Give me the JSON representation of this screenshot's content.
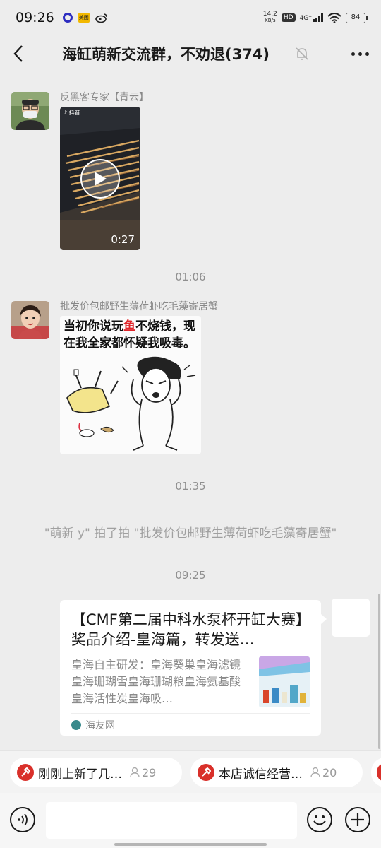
{
  "status_bar": {
    "time": "09:26",
    "net_speed_value": "14.2",
    "net_speed_unit": "KB/s",
    "hd": "HD",
    "network": "4G⁺",
    "battery": "84",
    "app_badge": "美团"
  },
  "nav": {
    "title": "海缸萌新交流群，不劝退(374)"
  },
  "messages": [
    {
      "sender": "反黑客专家【青云】",
      "type": "video",
      "duration": "0:27",
      "tiktok_label": "抖音"
    },
    {
      "sender": "批发价包邮野生薄荷虾吃毛藻寄居蟹",
      "type": "sticker",
      "caption_parts": [
        "当初你说玩",
        "鱼",
        "不烧钱，现在我全家都怀疑我吸毒。"
      ]
    }
  ],
  "timestamps": [
    "01:06",
    "01:35",
    "09:25"
  ],
  "system_notice": "\"萌新 y\" 拍了拍 \"批发价包邮野生薄荷虾吃毛藻寄居蟹\"",
  "link_card": {
    "title": "【CMF第二届中科水泵杯开缸大赛】奖品介绍-皇海篇，转发送…",
    "description": "皇海自主研发：皇海葵巢皇海滤镜皇海珊瑚雪皇海珊瑚粮皇海氨基酸皇海活性炭皇海吸…",
    "source": "海友网"
  },
  "chips": [
    {
      "label": "刚刚上新了几…",
      "count": "29"
    },
    {
      "label": "本店诚信经营…",
      "count": "20"
    }
  ],
  "colors": {
    "background": "#ededed",
    "chip_icon": "#d9302a",
    "sticker_accent": "#e0262b"
  }
}
